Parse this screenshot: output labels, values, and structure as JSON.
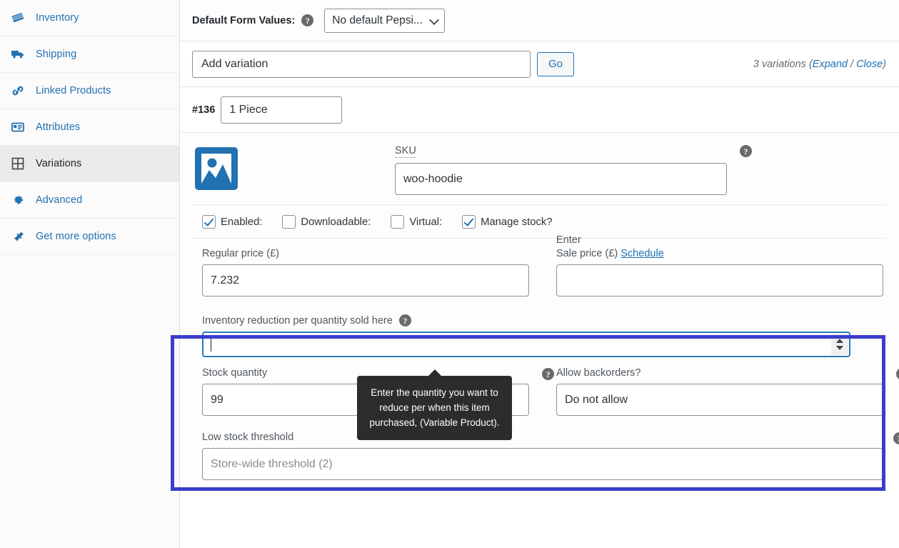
{
  "sidebar": {
    "items": [
      {
        "label": "Inventory",
        "icon": "inventory-icon",
        "active": false
      },
      {
        "label": "Shipping",
        "icon": "truck-icon",
        "active": false
      },
      {
        "label": "Linked Products",
        "icon": "link-icon",
        "active": false
      },
      {
        "label": "Attributes",
        "icon": "attributes-icon",
        "active": false
      },
      {
        "label": "Variations",
        "icon": "grid-icon",
        "active": true
      },
      {
        "label": "Advanced",
        "icon": "gear-icon",
        "active": false
      },
      {
        "label": "Get more options",
        "icon": "plug-icon",
        "active": false
      }
    ]
  },
  "defaults_row": {
    "label": "Default Form Values:",
    "help": "?",
    "select_value": "No default Pepsi..."
  },
  "addvar_row": {
    "select_value": "Add variation",
    "go_label": "Go",
    "count_text": "3 variations",
    "expand_label": "Expand",
    "separator": " / ",
    "close_label": "Close",
    "paren_open": "(",
    "paren_close": ")"
  },
  "variation": {
    "id": "#136",
    "attribute_value": "1 Piece",
    "sku_label": "SKU",
    "sku_value": "woo-hoodie",
    "sku_help": "?",
    "image_alt": "image-placeholder",
    "checkboxes": [
      {
        "label": "Enabled:",
        "checked": true,
        "name": "enabled"
      },
      {
        "label": "Downloadable:",
        "checked": false,
        "name": "downloadable"
      },
      {
        "label": "Virtual:",
        "checked": false,
        "name": "virtual"
      },
      {
        "label": "Manage stock?",
        "checked": true,
        "name": "manage-stock"
      }
    ],
    "pricing": {
      "enter_note": "Enter",
      "regular_label": "Regular price (£)",
      "regular_value": "7.232",
      "sale_label": "Sale price (£)",
      "sale_value": "",
      "schedule_label": "Schedule"
    },
    "inventory_reduction": {
      "label": "Inventory reduction per quantity sold here",
      "help": "?",
      "value": "",
      "tooltip": "Enter the quantity you want to reduce per when this item purchased, (Variable Product)."
    },
    "stock": {
      "quantity_label": "Stock quantity",
      "quantity_value": "99",
      "quantity_help": "?",
      "backorders_label": "Allow backorders?",
      "backorders_value": "Do not allow",
      "backorders_help": "?"
    },
    "low_stock": {
      "label": "Low stock threshold",
      "placeholder": "Store-wide threshold (2)",
      "value": "",
      "help": "?"
    }
  },
  "colors": {
    "link": "#2271b1",
    "highlight_border": "#3d3dcb",
    "focus_border": "#2b7bb9",
    "tooltip_bg": "#2c2c2c",
    "sidebar_active_bg": "#eaeaea"
  }
}
